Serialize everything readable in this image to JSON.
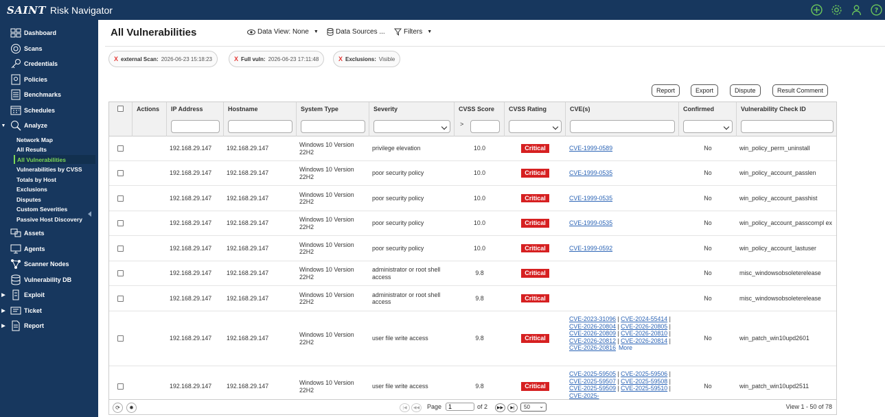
{
  "app": {
    "brand": "SAINT",
    "title": "Risk Navigator"
  },
  "colors": {
    "navy": "#17375e",
    "accent_green": "#7ed957",
    "critical": "#d62021",
    "link": "#2a63b5"
  },
  "top_icons": [
    "plus-circle-icon",
    "gear-icon",
    "user-icon",
    "help-icon"
  ],
  "sidebar": {
    "items": [
      {
        "label": "Dashboard",
        "icon": "dashboard-icon"
      },
      {
        "label": "Scans",
        "icon": "scans-icon"
      },
      {
        "label": "Credentials",
        "icon": "key-icon"
      },
      {
        "label": "Policies",
        "icon": "policies-icon"
      },
      {
        "label": "Benchmarks",
        "icon": "benchmarks-icon"
      },
      {
        "label": "Schedules",
        "icon": "calendar-icon"
      },
      {
        "label": "Analyze",
        "icon": "analyze-icon",
        "expanded": true
      },
      {
        "label": "Assets",
        "icon": "assets-icon"
      },
      {
        "label": "Agents",
        "icon": "agents-icon"
      },
      {
        "label": "Scanner Nodes",
        "icon": "nodes-icon"
      },
      {
        "label": "Vulnerability DB",
        "icon": "database-icon"
      },
      {
        "label": "Exploit",
        "icon": "exploit-icon"
      },
      {
        "label": "Ticket",
        "icon": "ticket-icon"
      },
      {
        "label": "Report",
        "icon": "report-icon"
      }
    ],
    "analyze_sub": [
      "Network Map",
      "All Results",
      "All Vulnerabilities",
      "Vulnerabilities by CVSS",
      "Totals by Host",
      "Exclusions",
      "Disputes",
      "Custom Severities",
      "Passive Host Discovery"
    ],
    "active_sub": "All Vulnerabilities"
  },
  "page": {
    "title": "All Vulnerabilities",
    "data_view": "Data View: None",
    "data_sources": "Data Sources ...",
    "filters": "Filters"
  },
  "chips": [
    {
      "key": "external Scan:",
      "value": "2026-06-23 15:18:23"
    },
    {
      "key": "Full vuln:",
      "value": "2026-06-23 17:11:48"
    },
    {
      "key": "Exclusions:",
      "value": "Visible"
    }
  ],
  "chip_remove": "X",
  "actions": {
    "report": "Report",
    "export": "Export",
    "dispute": "Dispute",
    "result_comment": "Result Comment"
  },
  "columns": {
    "actions": "Actions",
    "ip": "IP Address",
    "hostname": "Hostname",
    "system_type": "System Type",
    "severity": "Severity",
    "cvss_score": "CVSS Score",
    "cvss_rating": "CVSS Rating",
    "cves": "CVE(s)",
    "confirmed": "Confirmed",
    "check_id": "Vulnerability Check ID",
    "cvss_op": ">"
  },
  "rows": [
    {
      "ip": "192.168.29.147",
      "host": "192.168.29.147",
      "sys": "Windows 10 Version 22H2",
      "sev": "privilege elevation",
      "score": "10.0",
      "rating": "Critical",
      "cves": [
        "CVE-1999-0589"
      ],
      "more": "",
      "confirmed": "No",
      "check": "win_policy_perm_uninstall"
    },
    {
      "ip": "192.168.29.147",
      "host": "192.168.29.147",
      "sys": "Windows 10 Version 22H2",
      "sev": "poor security policy",
      "score": "10.0",
      "rating": "Critical",
      "cves": [
        "CVE-1999-0535"
      ],
      "more": "",
      "confirmed": "No",
      "check": "win_policy_account_passlen"
    },
    {
      "ip": "192.168.29.147",
      "host": "192.168.29.147",
      "sys": "Windows 10 Version 22H2",
      "sev": "poor security policy",
      "score": "10.0",
      "rating": "Critical",
      "cves": [
        "CVE-1999-0535"
      ],
      "more": "",
      "confirmed": "No",
      "check": "win_policy_account_passhist"
    },
    {
      "ip": "192.168.29.147",
      "host": "192.168.29.147",
      "sys": "Windows 10 Version 22H2",
      "sev": "poor security policy",
      "score": "10.0",
      "rating": "Critical",
      "cves": [
        "CVE-1999-0535"
      ],
      "more": "",
      "confirmed": "No",
      "check": "win_policy_account_passcompl ex"
    },
    {
      "ip": "192.168.29.147",
      "host": "192.168.29.147",
      "sys": "Windows 10 Version 22H2",
      "sev": "poor security policy",
      "score": "10.0",
      "rating": "Critical",
      "cves": [
        "CVE-1999-0592"
      ],
      "more": "",
      "confirmed": "No",
      "check": "win_policy_account_lastuser"
    },
    {
      "ip": "192.168.29.147",
      "host": "192.168.29.147",
      "sys": "Windows 10 Version 22H2",
      "sev": "administrator or root shell access",
      "score": "9.8",
      "rating": "Critical",
      "cves": [],
      "more": "",
      "confirmed": "No",
      "check": "misc_windowsobsoleterelease"
    },
    {
      "ip": "192.168.29.147",
      "host": "192.168.29.147",
      "sys": "Windows 10 Version 22H2",
      "sev": "administrator or root shell access",
      "score": "9.8",
      "rating": "Critical",
      "cves": [],
      "more": "",
      "confirmed": "No",
      "check": "misc_windowsobsoleterelease"
    },
    {
      "ip": "192.168.29.147",
      "host": "192.168.29.147",
      "sys": "Windows 10 Version 22H2",
      "sev": "user file write access",
      "score": "9.8",
      "rating": "Critical",
      "cves": [
        "CVE-2023-31096",
        "CVE-2024-55414",
        "CVE-2026-20804",
        "CVE-2026-20805",
        "CVE-2026-20809",
        "CVE-2026-20810",
        "CVE-2026-20812",
        "CVE-2026-20814",
        "CVE-2026-20816"
      ],
      "more": "More",
      "confirmed": "No",
      "check": "win_patch_win10upd2601"
    },
    {
      "ip": "192.168.29.147",
      "host": "192.168.29.147",
      "sys": "Windows 10 Version 22H2",
      "sev": "user file write access",
      "score": "9.8",
      "rating": "Critical",
      "cves": [
        "CVE-2025-59505",
        "CVE-2025-59506",
        "CVE-2025-59507",
        "CVE-2025-59508",
        "CVE-2025-59509",
        "CVE-2025-59510",
        "CVE-2025-"
      ],
      "more": "",
      "confirmed": "No",
      "check": "win_patch_win10upd2511"
    }
  ],
  "footer": {
    "page_label": "Page",
    "page_value": "1",
    "of_label": "of 2",
    "per_page": "50",
    "summary": "View 1 - 50 of 78"
  }
}
